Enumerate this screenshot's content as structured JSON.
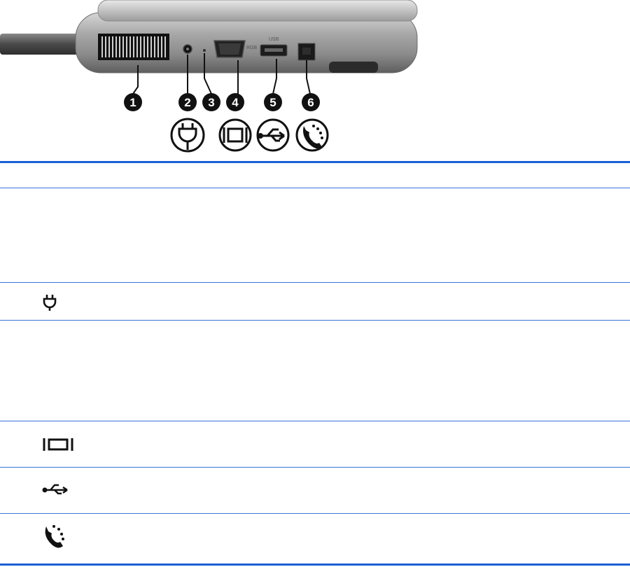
{
  "figure": {
    "callouts": [
      {
        "number": "1"
      },
      {
        "number": "2"
      },
      {
        "number": "3"
      },
      {
        "number": "4"
      },
      {
        "number": "5"
      },
      {
        "number": "6"
      }
    ],
    "port_labels": {
      "vga": "RGB",
      "usb": "USB"
    },
    "icons": [
      "power-plug-icon",
      "external-monitor-icon",
      "usb-icon",
      "modem-phone-icon"
    ]
  },
  "table": {
    "rows": [
      {
        "id": "1",
        "icon": null
      },
      {
        "id": "2",
        "icon": "power-plug-icon"
      },
      {
        "id": "3",
        "icon": null
      },
      {
        "id": "4",
        "icon": "external-monitor-icon"
      },
      {
        "id": "5",
        "icon": "usb-icon"
      },
      {
        "id": "6",
        "icon": "modem-phone-icon"
      }
    ]
  },
  "colors": {
    "rule": "#1a5fd6",
    "device_body": "#9a9a9a",
    "device_dark": "#1e1e1e",
    "callout": "#111111"
  }
}
